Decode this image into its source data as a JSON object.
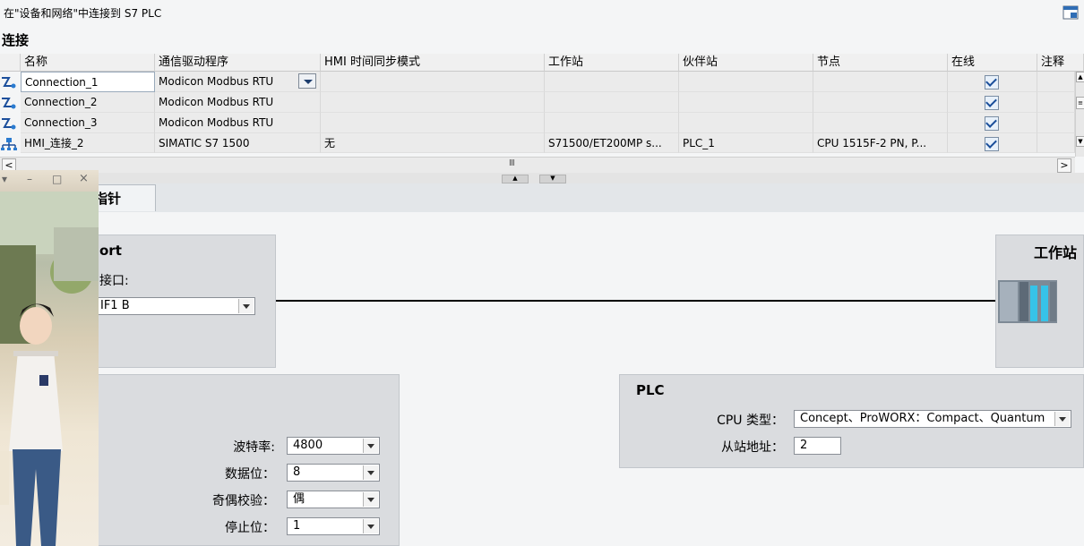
{
  "top_info": {
    "text": "在\"设备和网络\"中连接到 S7 PLC",
    "toggle_icon": "split-view-icon"
  },
  "connections": {
    "title": "连接",
    "columns": [
      "名称",
      "通信驱动程序",
      "HMI 时间同步模式",
      "工作站",
      "伙伴站",
      "节点",
      "在线",
      "注释"
    ],
    "rows": [
      {
        "name": "Connection_1",
        "driver": "Modicon Modbus RTU",
        "sync": "",
        "station": "",
        "partner": "",
        "node": "",
        "online": true,
        "comment": "",
        "icon": "modbus-connection-icon"
      },
      {
        "name": "Connection_2",
        "driver": "Modicon Modbus RTU",
        "sync": "",
        "station": "",
        "partner": "",
        "node": "",
        "online": true,
        "comment": "",
        "icon": "modbus-connection-icon"
      },
      {
        "name": "Connection_3",
        "driver": "Modicon Modbus RTU",
        "sync": "",
        "station": "",
        "partner": "",
        "node": "",
        "online": true,
        "comment": "",
        "icon": "modbus-connection-icon"
      },
      {
        "name": "HMI_连接_2",
        "driver": "SIMATIC S7 1500",
        "sync": "无",
        "station": "S71500/ET200MP s...",
        "partner": "PLC_1",
        "node": "CPU 1515F-2 PN, P...",
        "online": true,
        "comment": "",
        "icon": "network-connection-icon"
      }
    ],
    "scroll_mid_glyph": "Ⅲ"
  },
  "tabs": {
    "pointer": "指针"
  },
  "left_panel": {
    "title_fragment": "ort",
    "interface_label": "接口:",
    "interface_value": "IF1 B"
  },
  "station_panel": {
    "title": "工作站",
    "icon": "plc-station-icon"
  },
  "serial_params": {
    "baud_label": "波特率:",
    "baud_value": "4800",
    "data_bits_label": "数据位：",
    "data_bits_value": "8",
    "parity_label": "奇偶校验：",
    "parity_value": "偶",
    "stop_bits_label": "停止位：",
    "stop_bits_value": "1"
  },
  "plc_panel": {
    "title": "PLC",
    "cpu_label": "CPU 类型：",
    "cpu_value": "Concept、ProWORX：Compact、Quantum",
    "slave_label": "从站地址：",
    "slave_value": "2"
  },
  "overlay": {
    "window_controls": [
      "▾",
      "–",
      "□",
      "×"
    ]
  },
  "colors": {
    "header_bg": "#f0f0f0",
    "panel_bg": "#dadcdf",
    "check_blue": "#1a4e9a"
  }
}
